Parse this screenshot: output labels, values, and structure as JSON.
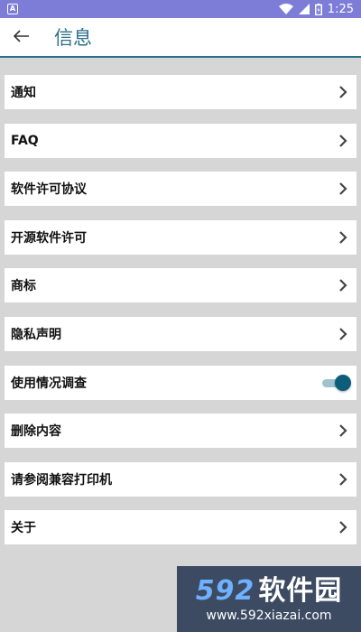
{
  "status_bar": {
    "notification_glyph": "A",
    "time": "1:25",
    "icons": [
      "wifi-icon",
      "signal-icon",
      "battery-icon"
    ]
  },
  "app_bar": {
    "title": "信息"
  },
  "items": [
    {
      "label": "通知",
      "control": "chevron"
    },
    {
      "label": "FAQ",
      "control": "chevron"
    },
    {
      "label": "软件许可协议",
      "control": "chevron"
    },
    {
      "label": "开源软件许可",
      "control": "chevron"
    },
    {
      "label": "商标",
      "control": "chevron"
    },
    {
      "label": "隐私声明",
      "control": "chevron"
    },
    {
      "label": "使用情况调查",
      "control": "toggle",
      "toggle_on": true
    },
    {
      "label": "删除内容",
      "control": "chevron"
    },
    {
      "label": "请参阅兼容打印机",
      "control": "chevron"
    },
    {
      "label": "关于",
      "control": "chevron"
    }
  ],
  "watermark": {
    "logo_number": "592",
    "logo_text": "软件园",
    "url": "www.592xiazai.com"
  },
  "colors": {
    "status_bar": "#7d7dd8",
    "accent": "#2b6f8a",
    "background": "#d6d6d6",
    "toggle_thumb": "#0d5d7a",
    "toggle_track": "#9fc2d0"
  }
}
